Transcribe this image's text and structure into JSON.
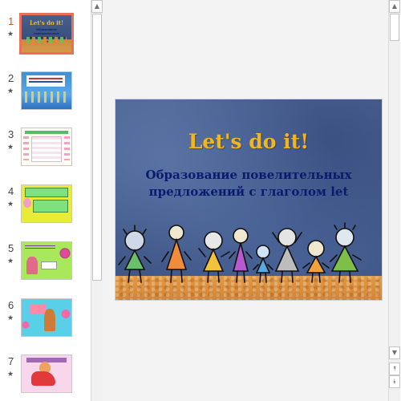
{
  "thumbnails": {
    "items": [
      {
        "number": "1",
        "star": "★",
        "active": true
      },
      {
        "number": "2",
        "star": "★",
        "active": false
      },
      {
        "number": "3",
        "star": "★",
        "active": false
      },
      {
        "number": "4",
        "star": "★",
        "active": false
      },
      {
        "number": "5",
        "star": "★",
        "active": false
      },
      {
        "number": "6",
        "star": "★",
        "active": false
      },
      {
        "number": "7",
        "star": "★",
        "active": false
      }
    ],
    "slide1_title": "Let's do it!",
    "slide1_subtitle": "Образование повелительных предложений с глаголом let"
  },
  "slide": {
    "title": "Let's do it!",
    "subtitle_line1": "Образование повелительных",
    "subtitle_line2": "предложений с глаголом let"
  },
  "scrollbar": {
    "up_icon": "▲",
    "down_icon": "▼",
    "prev_slide_icon": "⯭",
    "next_slide_icon": "⯯"
  },
  "colors": {
    "accent_active_thumb": "#e8705a",
    "active_number": "#c55a11",
    "title": "#f3b51f",
    "subtitle": "#0c1a6e"
  }
}
